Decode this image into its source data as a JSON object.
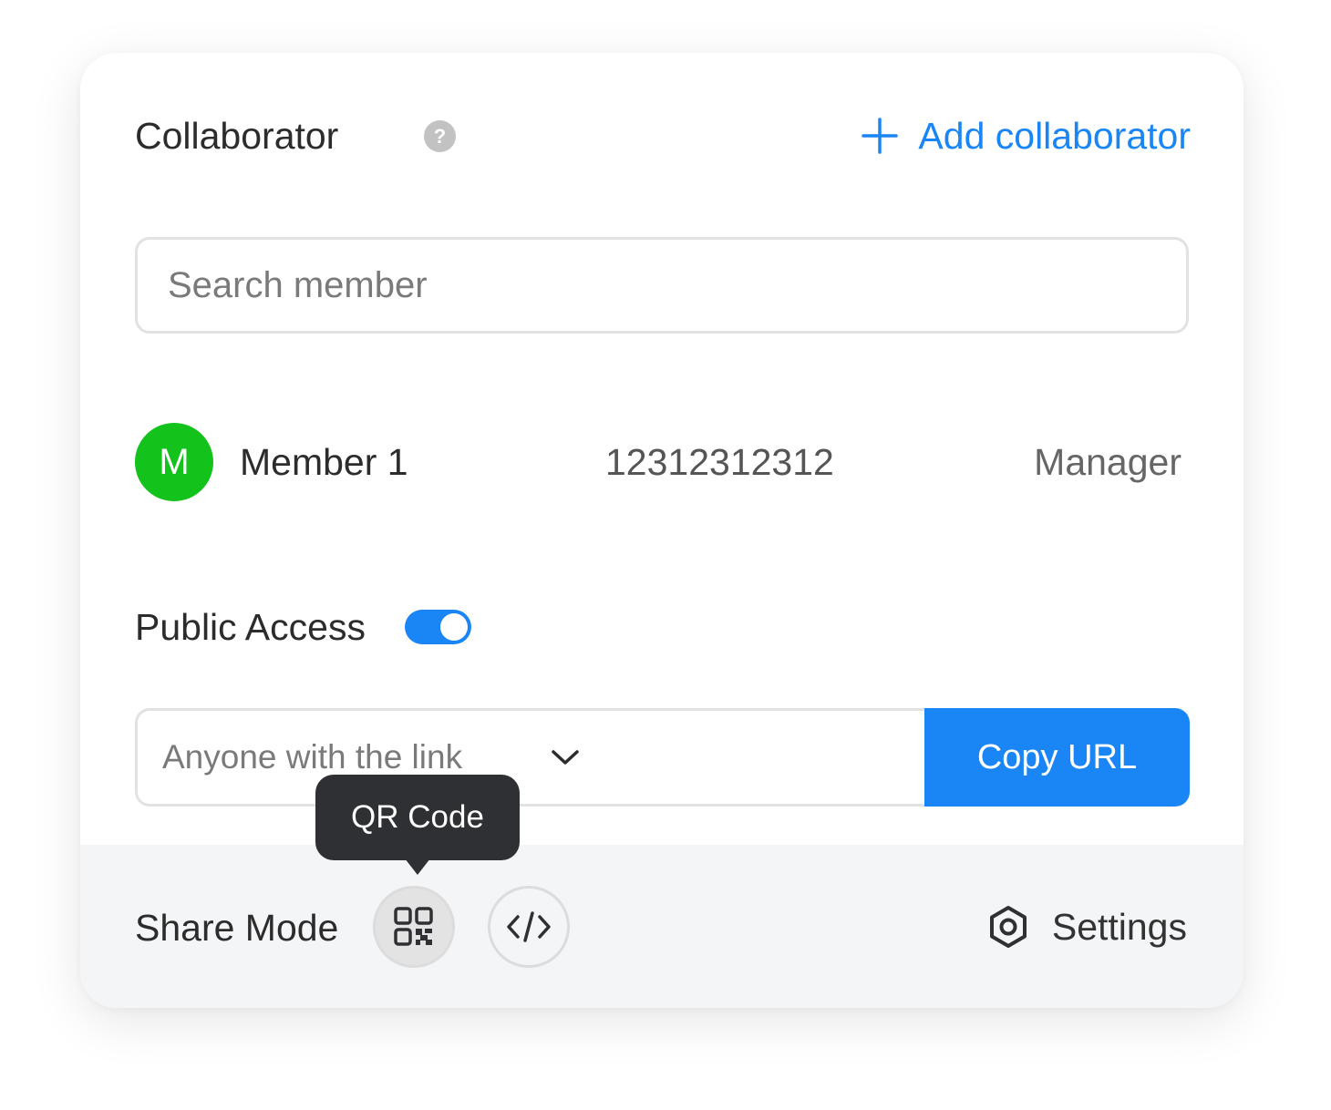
{
  "header": {
    "title": "Collaborator",
    "help_icon": "question-icon",
    "add_label": "Add collaborator",
    "add_icon": "plus-icon"
  },
  "search": {
    "placeholder": "Search member",
    "value": ""
  },
  "members": [
    {
      "avatar_initial": "M",
      "avatar_color": "#13c21b",
      "name": "Member 1",
      "phone": "12312312312",
      "role": "Manager"
    }
  ],
  "public_access": {
    "label": "Public Access",
    "enabled": true
  },
  "link": {
    "selected_option": "Anyone with the link",
    "copy_label": "Copy URL"
  },
  "footer": {
    "share_mode_label": "Share Mode",
    "modes": [
      {
        "name": "qr-code",
        "icon": "qr-code-icon",
        "active": true
      },
      {
        "name": "embed-code",
        "icon": "code-icon",
        "active": false
      }
    ],
    "settings_label": "Settings",
    "settings_icon": "settings-icon"
  },
  "tooltip": {
    "text": "QR Code"
  },
  "colors": {
    "accent": "#1a86f5",
    "avatar": "#13c21b",
    "footer_bg": "#f4f5f7",
    "tooltip_bg": "#2f3033"
  }
}
